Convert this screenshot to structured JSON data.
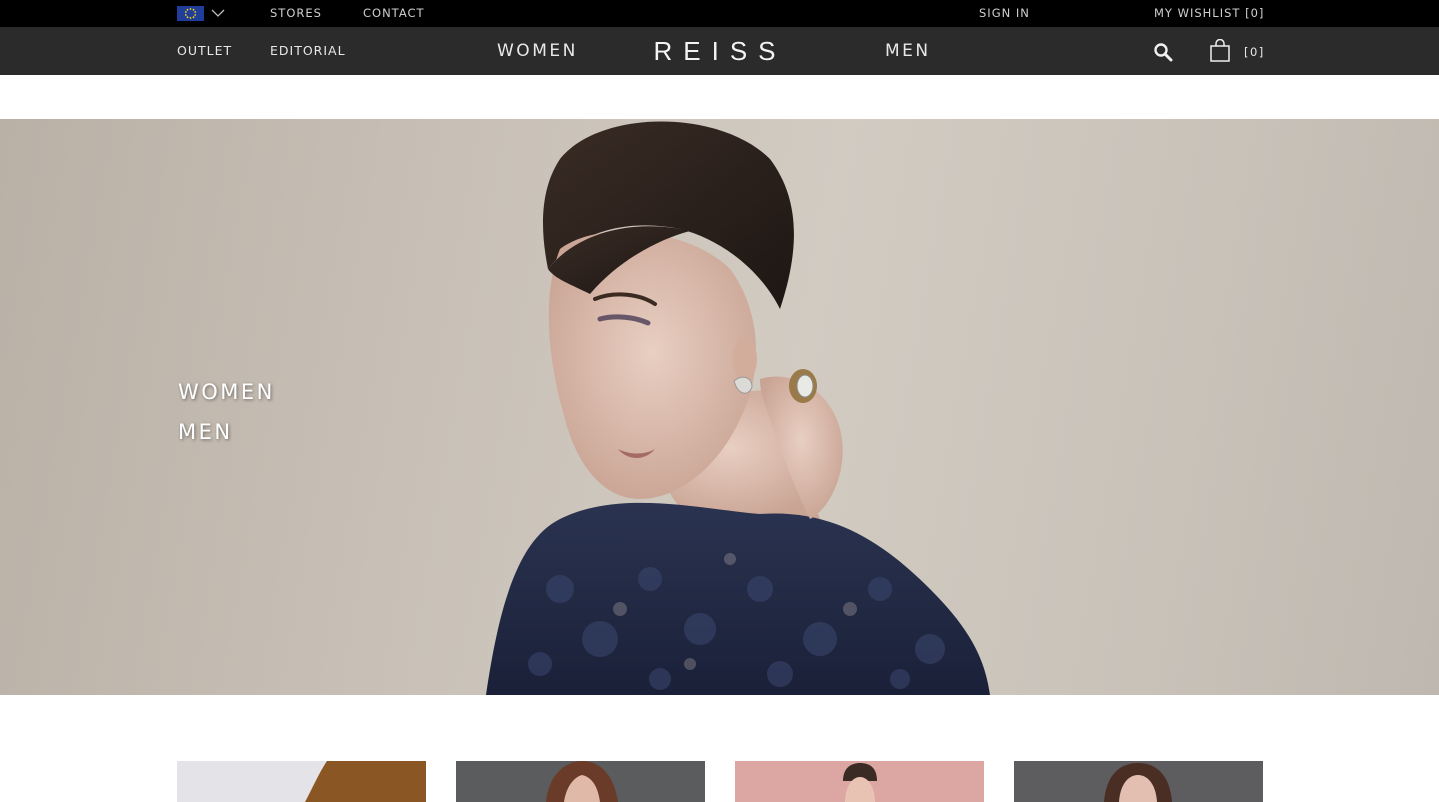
{
  "topbar": {
    "region_flag_icon": "eu-flag-icon",
    "region_chevron_icon": "chevron-down-icon",
    "stores_label": "STORES",
    "contact_label": "CONTACT",
    "sign_in_label": "SIGN IN",
    "wishlist_label": "MY WISHLIST [0]"
  },
  "nav": {
    "outlet_label": "OUTLET",
    "editorial_label": "EDITORIAL",
    "women_label": "WOMEN",
    "brand": "REISS",
    "men_label": "MEN",
    "search_icon": "search-icon",
    "bag_icon": "shopping-bag-icon",
    "bag_count": "[0]"
  },
  "hero": {
    "women_link": "WOMEN",
    "men_link": "MEN"
  },
  "tiles": [
    {
      "name": "tile-1"
    },
    {
      "name": "tile-2"
    },
    {
      "name": "tile-3"
    },
    {
      "name": "tile-4"
    }
  ],
  "colors": {
    "topbar_bg": "#000000",
    "nav_bg": "#2b2b2b",
    "page_bg": "#ffffff"
  }
}
